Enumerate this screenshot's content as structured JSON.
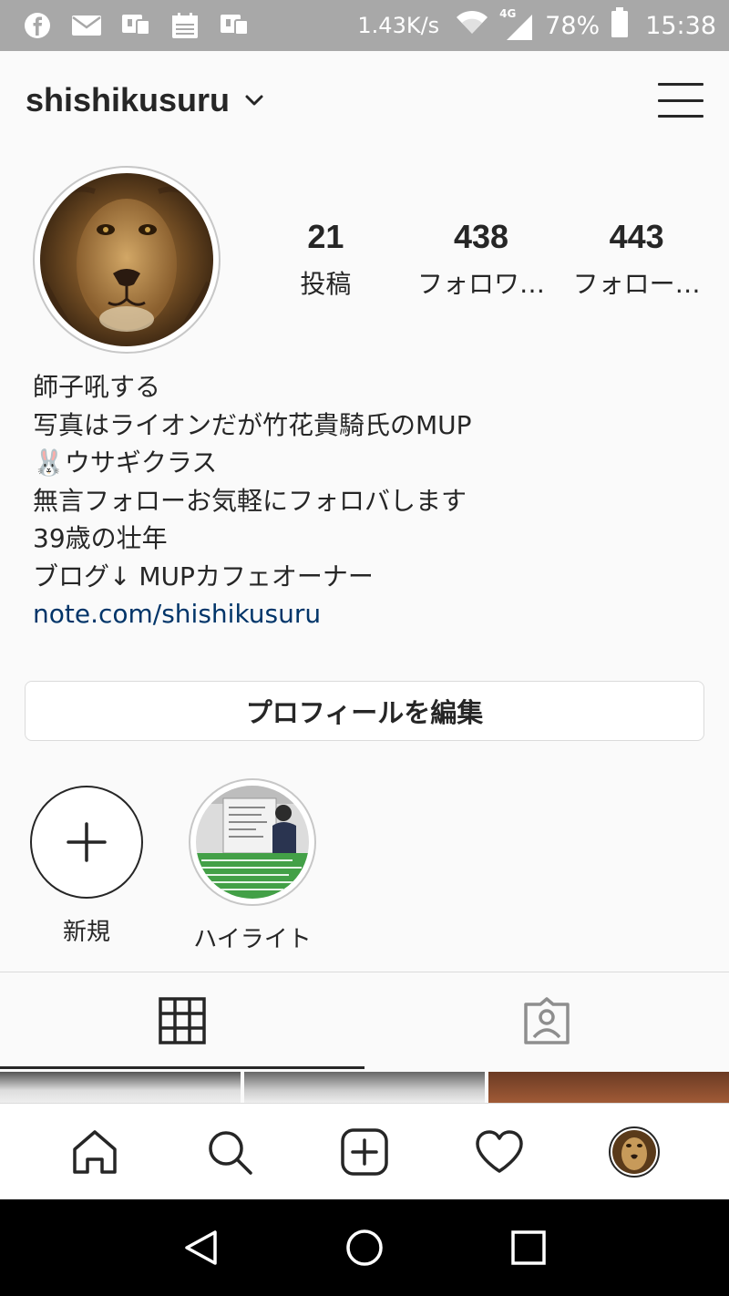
{
  "status_bar": {
    "speed": "1.43K/s",
    "network": "4G",
    "battery": "78%",
    "time": "15:38",
    "icons": [
      "facebook-icon",
      "mail-icon",
      "notification-icon",
      "calendar-icon",
      "notification-icon"
    ]
  },
  "header": {
    "username": "shishikusuru"
  },
  "stats": [
    {
      "value": "21",
      "label": "投稿"
    },
    {
      "value": "438",
      "label": "フォロワ…"
    },
    {
      "value": "443",
      "label": "フォロー…"
    }
  ],
  "bio": {
    "name": "師子吼する",
    "lines": [
      "写真はライオンだが竹花貴騎氏のMUP",
      "🐰ウサギクラス",
      "無言フォローお気軽にフォロバします",
      "39歳の壮年",
      "ブログ↓ MUPカフェオーナー"
    ],
    "link": "note.com/shishikusuru"
  },
  "edit_profile_label": "プロフィールを編集",
  "highlights": [
    {
      "label": "新規"
    },
    {
      "label": "ハイライト"
    }
  ],
  "colors": {
    "status_bar": "#a8a8a8",
    "link": "#003569",
    "text": "#262626",
    "border": "#dbdbdb"
  }
}
